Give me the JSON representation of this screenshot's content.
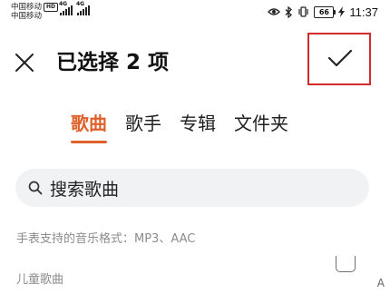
{
  "status_bar": {
    "carrier_1": "中国移动",
    "carrier_1_badge": "HD",
    "carrier_2": "中国移动",
    "signal_1_gen": "4G",
    "signal_2_gen": "4G",
    "battery_level": "66",
    "time": "11:37",
    "icons": [
      "eye-icon",
      "bluetooth-icon",
      "vibrate-icon",
      "battery-icon",
      "charging-icon"
    ]
  },
  "title_bar": {
    "close_icon": "close-icon",
    "title": "已选择 2 项",
    "confirm_icon": "check-icon"
  },
  "tabs": [
    {
      "label": "歌曲",
      "active": true
    },
    {
      "label": "歌手",
      "active": false
    },
    {
      "label": "专辑",
      "active": false
    },
    {
      "label": "文件夹",
      "active": false
    }
  ],
  "search": {
    "placeholder": "搜索歌曲"
  },
  "hint": "手表支持的音乐格式：MP3、AAC",
  "list": {
    "items": [
      {
        "title_partial": "…",
        "subtitle": "儿童歌曲"
      }
    ],
    "index_letter": "A"
  },
  "colors": {
    "accent": "#e0602c",
    "highlight_box": "#d42a2a",
    "hint_text": "#8c8c8c",
    "search_bg": "#f1f2f4"
  }
}
